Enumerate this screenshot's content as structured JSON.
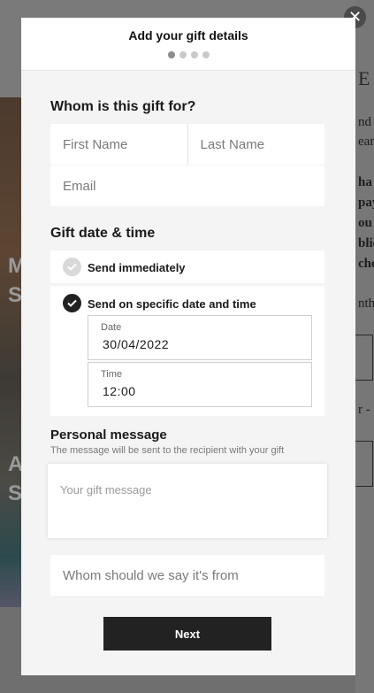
{
  "modal": {
    "title": "Add your gift details",
    "steps_total": 4,
    "current_step": 1,
    "close_icon": "close-icon"
  },
  "recipient": {
    "heading": "Whom is this gift for?",
    "first_name_placeholder": "First Name",
    "last_name_placeholder": "Last Name",
    "email_placeholder": "Email"
  },
  "gift_date": {
    "heading": "Gift date & time",
    "option_immediate": "Send immediately",
    "option_specific": "Send on specific date and time",
    "selected": "specific",
    "date_label": "Date",
    "date_value": "30/04/2022",
    "time_label": "Time",
    "time_value": "12:00"
  },
  "message": {
    "heading": "Personal message",
    "subtitle": "The message will be sent to the recipient with your gift",
    "placeholder": "Your gift message",
    "from_placeholder": "Whom should we say it's from"
  },
  "actions": {
    "next_label": "Next"
  },
  "background": {
    "photo_fragments": [
      "M",
      "S",
      "A",
      "S"
    ],
    "right_fragments": [
      "E",
      "nd",
      "ear",
      "ha",
      "pay",
      "ou",
      "blic",
      "che",
      "nth",
      "r -"
    ],
    "accent": "#222222"
  }
}
